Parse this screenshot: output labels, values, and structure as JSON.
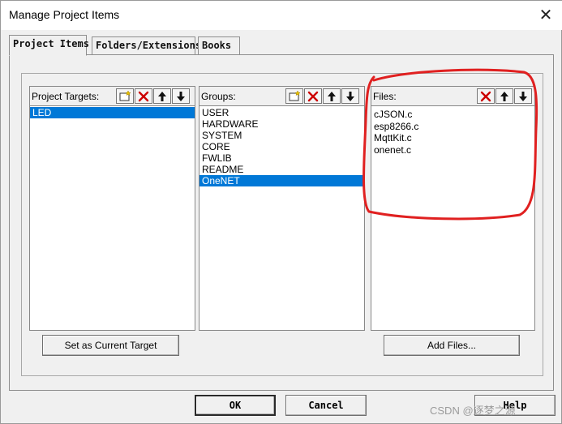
{
  "window": {
    "title": "Manage Project Items",
    "close_glyph": "✕"
  },
  "tabs": [
    {
      "label": "Project Items",
      "active": true
    },
    {
      "label": "Folders/Extensions",
      "active": false
    },
    {
      "label": "Books",
      "active": false
    }
  ],
  "targets": {
    "header": "Project Targets:",
    "items": [
      "LED"
    ],
    "selected": "LED",
    "set_current_label": "Set as Current Target"
  },
  "groups": {
    "header": "Groups:",
    "items": [
      "USER",
      "HARDWARE",
      "SYSTEM",
      "CORE",
      "FWLIB",
      "README",
      "OneNET"
    ],
    "selected": "OneNET"
  },
  "files": {
    "header": "Files:",
    "items": [
      "cJSON.c",
      "esp8266.c",
      "MqttKit.c",
      "onenet.c"
    ],
    "add_files_label": "Add Files..."
  },
  "toolbar_icons": {
    "new": "new-item-icon",
    "delete": "delete-icon",
    "up": "move-up-icon",
    "down": "move-down-icon"
  },
  "buttons": {
    "ok": "OK",
    "cancel": "Cancel",
    "help": "Help"
  },
  "colors": {
    "selection": "#0078d7",
    "annotation": "#e02020",
    "delete": "#cc0000"
  },
  "watermark": "CSDN @逐梦之源"
}
